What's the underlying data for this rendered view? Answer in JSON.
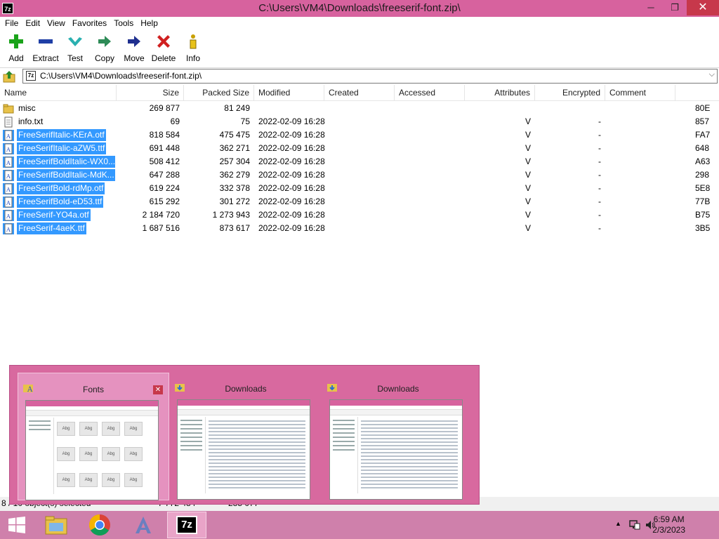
{
  "window": {
    "title": "C:\\Users\\VM4\\Downloads\\freeserif-font.zip\\",
    "app_icon": "7z",
    "minimize": "─",
    "restore": "❐",
    "close": "✕"
  },
  "menu": [
    "File",
    "Edit",
    "View",
    "Favorites",
    "Tools",
    "Help"
  ],
  "toolbar": [
    {
      "label": "Add",
      "icon": "plus-icon",
      "color": "#1aa31a"
    },
    {
      "label": "Extract",
      "icon": "minus-icon",
      "color": "#1f3fa6"
    },
    {
      "label": "Test",
      "icon": "check-icon",
      "color": "#2ab0b0"
    },
    {
      "label": "Copy",
      "icon": "copy-arrow-icon",
      "color": "#2e8b57"
    },
    {
      "label": "Move",
      "icon": "move-arrow-icon",
      "color": "#1f2f8f"
    },
    {
      "label": "Delete",
      "icon": "delete-x-icon",
      "color": "#d02020"
    },
    {
      "label": "Info",
      "icon": "info-icon",
      "color": "#c9a000"
    }
  ],
  "address": {
    "path": "C:\\Users\\VM4\\Downloads\\freeserif-font.zip\\"
  },
  "columns": [
    "Name",
    "Size",
    "Packed Size",
    "Modified",
    "Created",
    "Accessed",
    "Attributes",
    "Encrypted",
    "Comment"
  ],
  "files": [
    {
      "name": "misc",
      "type": "folder",
      "size": "269 877",
      "packed": "81 249",
      "modified": "",
      "attributes": "",
      "encrypted": "",
      "crc": "80E",
      "selected": false
    },
    {
      "name": "info.txt",
      "type": "text",
      "size": "69",
      "packed": "75",
      "modified": "2022-02-09 16:28",
      "attributes": "V",
      "encrypted": "-",
      "crc": "857",
      "selected": false
    },
    {
      "name": "FreeSerifItalic-KErA.otf",
      "type": "font",
      "size": "818 584",
      "packed": "475 475",
      "modified": "2022-02-09 16:28",
      "attributes": "V",
      "encrypted": "-",
      "crc": "FA7",
      "selected": true
    },
    {
      "name": "FreeSerifItalic-aZW5.ttf",
      "type": "font",
      "size": "691 448",
      "packed": "362 271",
      "modified": "2022-02-09 16:28",
      "attributes": "V",
      "encrypted": "-",
      "crc": "648",
      "selected": true
    },
    {
      "name": "FreeSerifBoldItalic-WX0...",
      "type": "font",
      "size": "508 412",
      "packed": "257 304",
      "modified": "2022-02-09 16:28",
      "attributes": "V",
      "encrypted": "-",
      "crc": "A63",
      "selected": true
    },
    {
      "name": "FreeSerifBoldItalic-MdK...",
      "type": "font",
      "size": "647 288",
      "packed": "362 279",
      "modified": "2022-02-09 16:28",
      "attributes": "V",
      "encrypted": "-",
      "crc": "298",
      "selected": true
    },
    {
      "name": "FreeSerifBold-rdMp.otf",
      "type": "font",
      "size": "619 224",
      "packed": "332 378",
      "modified": "2022-02-09 16:28",
      "attributes": "V",
      "encrypted": "-",
      "crc": "5E8",
      "selected": true
    },
    {
      "name": "FreeSerifBold-eD53.ttf",
      "type": "font",
      "size": "615 292",
      "packed": "301 272",
      "modified": "2022-02-09 16:28",
      "attributes": "V",
      "encrypted": "-",
      "crc": "77B",
      "selected": true
    },
    {
      "name": "FreeSerif-YO4a.otf",
      "type": "font",
      "size": "2 184 720",
      "packed": "1 273 943",
      "modified": "2022-02-09 16:28",
      "attributes": "V",
      "encrypted": "-",
      "crc": "B75",
      "selected": true
    },
    {
      "name": "FreeSerif-4aeK.ttf",
      "type": "font",
      "size": "1 687 516",
      "packed": "873 617",
      "modified": "2022-02-09 16:28",
      "attributes": "V",
      "encrypted": "-",
      "crc": "3B5",
      "selected": true
    }
  ],
  "status": {
    "selection": "8 / 10 object(s) selected",
    "size": "7 772 484",
    "packed": "285 077"
  },
  "thumbnails": [
    {
      "title": "Fonts",
      "active": true,
      "close": "✕",
      "kind": "grid",
      "items": [
        "Abg",
        "Abg",
        "Abg",
        "Abg",
        "Abg",
        "Abg",
        "Abg",
        "Abg",
        "Abg",
        "Abg",
        "Abg",
        "Abg"
      ]
    },
    {
      "title": "Downloads",
      "active": false,
      "kind": "list"
    },
    {
      "title": "Downloads",
      "active": false,
      "kind": "list"
    }
  ],
  "taskbar": {
    "apps": [
      "start-icon",
      "file-explorer-icon",
      "chrome-icon",
      "font-viewer-icon",
      "7zip-icon"
    ],
    "sevenzip_label": "7z",
    "time": "6:59 AM",
    "date": "2/3/2023"
  },
  "colors": {
    "accent": "#d7629e",
    "selection": "#3399ff",
    "taskbar": "#cf80ab"
  }
}
